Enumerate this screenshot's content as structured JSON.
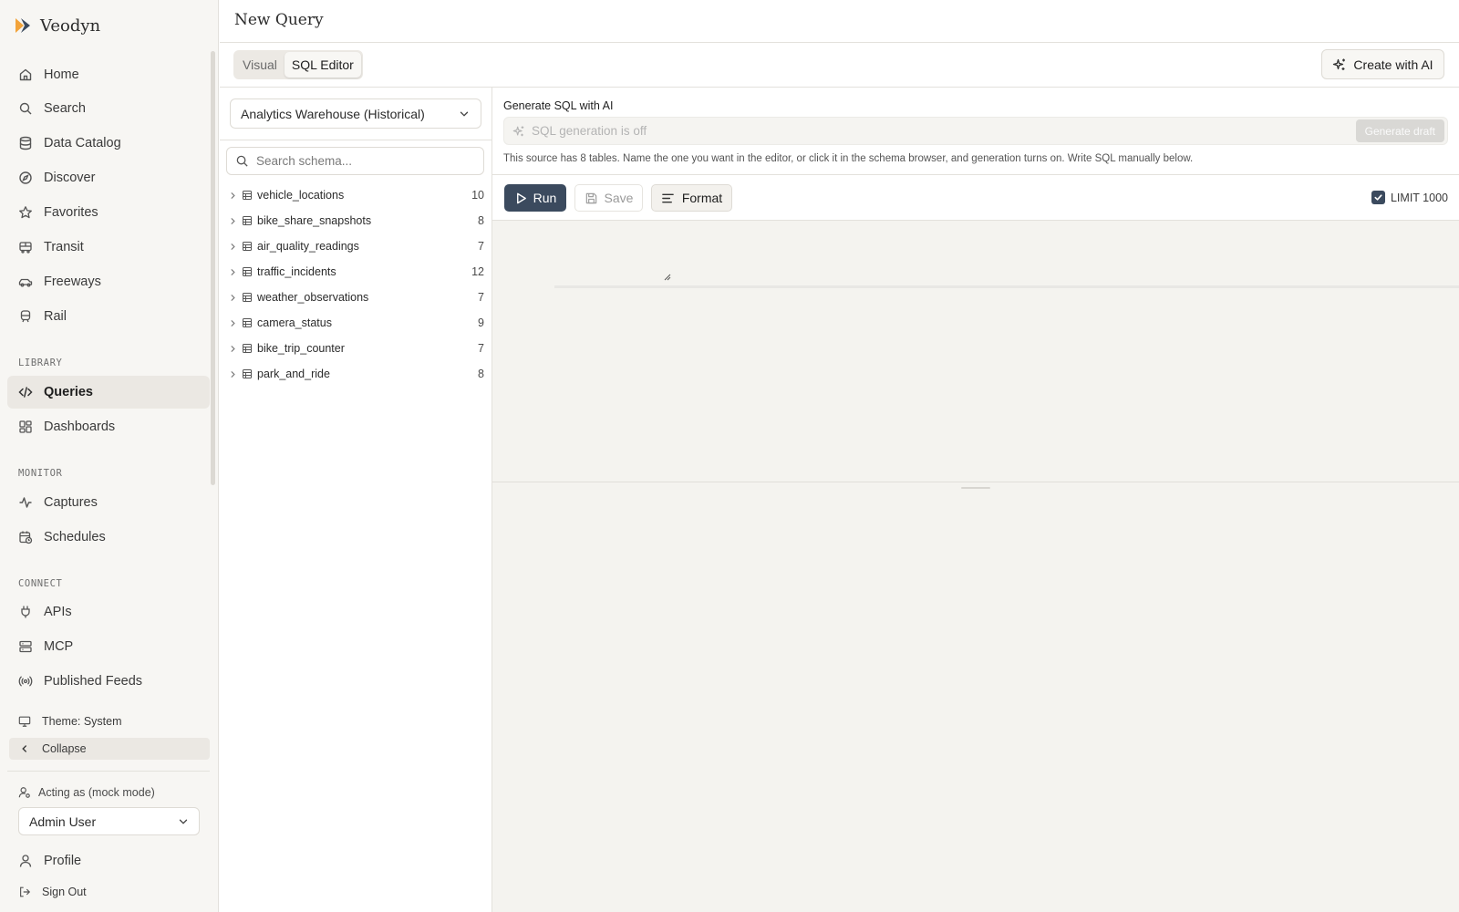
{
  "app": {
    "name": "Veodyn",
    "brand_colors": {
      "orange": "#f2a33a",
      "slate": "#3b4a5e"
    }
  },
  "sidebar": {
    "nav": [
      {
        "label": "Home",
        "icon": "home-icon"
      },
      {
        "label": "Search",
        "icon": "search-icon"
      },
      {
        "label": "Data Catalog",
        "icon": "database-icon"
      },
      {
        "label": "Discover",
        "icon": "compass-icon"
      },
      {
        "label": "Favorites",
        "icon": "star-icon"
      },
      {
        "label": "Transit",
        "icon": "bus-icon"
      },
      {
        "label": "Freeways",
        "icon": "car-icon"
      },
      {
        "label": "Rail",
        "icon": "train-icon"
      }
    ],
    "library": {
      "label": "LIBRARY",
      "items": [
        {
          "label": "Queries",
          "icon": "code-icon",
          "active": true
        },
        {
          "label": "Dashboards",
          "icon": "dashboard-icon"
        }
      ]
    },
    "monitor": {
      "label": "MONITOR",
      "items": [
        {
          "label": "Captures",
          "icon": "activity-icon"
        },
        {
          "label": "Schedules",
          "icon": "calendar-clock-icon"
        }
      ]
    },
    "connect": {
      "label": "CONNECT",
      "items": [
        {
          "label": "APIs",
          "icon": "plug-icon"
        },
        {
          "label": "MCP",
          "icon": "server-icon"
        },
        {
          "label": "Published Feeds",
          "icon": "radio-icon"
        }
      ]
    },
    "theme_label": "Theme: System",
    "collapse_label": "Collapse",
    "acting_as_label": "Acting as (mock mode)",
    "user_select_value": "Admin User",
    "profile_label": "Profile",
    "signout_label": "Sign Out"
  },
  "header": {
    "title": "New Query"
  },
  "toolbar": {
    "tabs": [
      {
        "label": "Visual",
        "active": false
      },
      {
        "label": "SQL Editor",
        "active": true
      }
    ],
    "create_ai_label": "Create with AI"
  },
  "schema": {
    "source_value": "Analytics Warehouse (Historical)",
    "search_placeholder": "Search schema...",
    "tables": [
      {
        "name": "vehicle_locations",
        "count": "10"
      },
      {
        "name": "bike_share_snapshots",
        "count": "8"
      },
      {
        "name": "air_quality_readings",
        "count": "7"
      },
      {
        "name": "traffic_incidents",
        "count": "12"
      },
      {
        "name": "weather_observations",
        "count": "7"
      },
      {
        "name": "camera_status",
        "count": "9"
      },
      {
        "name": "bike_trip_counter",
        "count": "7"
      },
      {
        "name": "park_and_ride",
        "count": "8"
      }
    ]
  },
  "editor": {
    "gen_label": "Generate SQL with AI",
    "gen_placeholder": "SQL generation is off",
    "gen_button": "Generate draft",
    "gen_help": "This source has 8 tables. Name the one you want in the editor, or click it in the schema browser, and generation turns on. Write SQL manually below.",
    "run_label": "Run",
    "save_label": "Save",
    "format_label": "Format",
    "limit_label": "LIMIT 1000",
    "limit_checked": true
  }
}
